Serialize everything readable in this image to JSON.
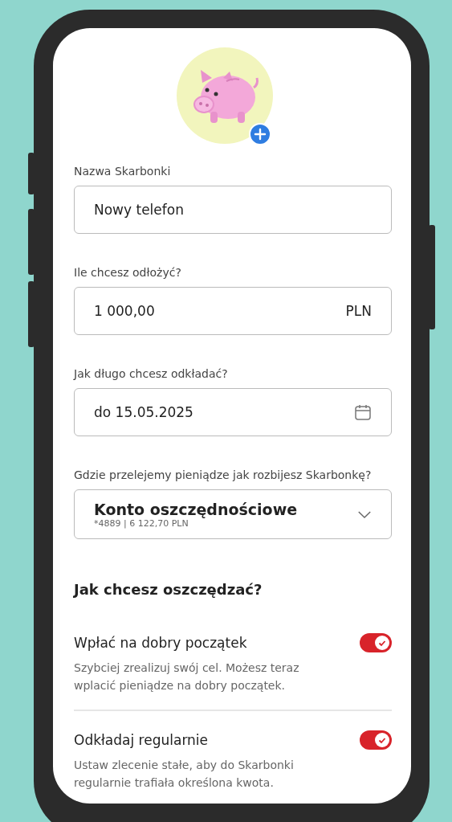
{
  "fields": [
    {
      "kind": "text",
      "label": "Nazwa Skarbonki",
      "value": "Nowy telefon"
    },
    {
      "kind": "amount",
      "label": "Ile chcesz odłożyć?",
      "value": "1 000,00",
      "suffix": "PLN"
    },
    {
      "kind": "date",
      "label": "Jak długo chcesz odkładać?",
      "value": "do 15.05.2025"
    },
    {
      "kind": "select",
      "label": "Gdzie przelejemy pieniądze jak rozbijesz Skarbonkę?",
      "value": "Konto oszczędnościowe",
      "detail": "*4889 | 6 122,70 PLN"
    }
  ],
  "section_title": "Jak chcesz oszczędzać?",
  "options": [
    {
      "title": "Wpłać na dobry początek",
      "description": "Szybciej zrealizuj swój cel. Możesz teraz wplacić pieniądze na dobry początek.",
      "on": true
    },
    {
      "title": "Odkładaj regularnie",
      "description": "Ustaw zlecenie stałe, aby do Skarbonki regularnie trafiała określona kwota.",
      "on": true
    }
  ]
}
